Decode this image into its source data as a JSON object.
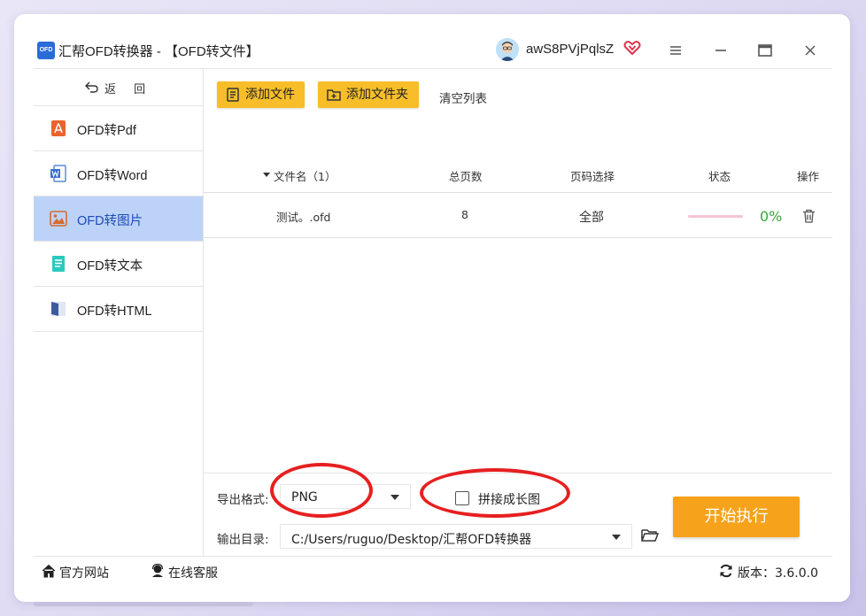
{
  "window": {
    "logo_text": "OFD",
    "title": "汇帮OFD转换器 - 【OFD转文件】",
    "username": "awS8PVjPqlsZ"
  },
  "sidebar": {
    "back_label": "返 回",
    "items": [
      {
        "label": "OFD转Pdf",
        "icon": "pdf-icon",
        "color": "#e8642e"
      },
      {
        "label": "OFD转Word",
        "icon": "word-icon",
        "color": "#3b6fd0"
      },
      {
        "label": "OFD转图片",
        "icon": "image-icon",
        "color": "#d96a2b",
        "active": true
      },
      {
        "label": "OFD转文本",
        "icon": "text-icon",
        "color": "#2bc9c0"
      },
      {
        "label": "OFD转HTML",
        "icon": "html-icon",
        "color": "#3d5a9e"
      }
    ]
  },
  "toolbar": {
    "add_file": "添加文件",
    "add_folder": "添加文件夹",
    "clear_list": "清空列表"
  },
  "table": {
    "headers": {
      "name": "文件名（1）",
      "pages": "总页数",
      "page_select": "页码选择",
      "status": "状态",
      "action": "操作"
    },
    "rows": [
      {
        "name": "测试。.ofd",
        "pages": "8",
        "page_select": "全部",
        "progress": 0,
        "progress_text": "0%"
      }
    ]
  },
  "settings": {
    "format_label": "导出格式:",
    "format_value": "PNG",
    "merge_label": "拼接成长图",
    "merge_checked": false,
    "output_label": "输出目录:",
    "output_value": "C:/Users/ruguo/Desktop/汇帮OFD转换器",
    "start_button": "开始执行"
  },
  "footer": {
    "website": "官方网站",
    "support": "在线客服",
    "version": "版本：3.6.0.0"
  },
  "colors": {
    "accent_yellow": "#f7be2a",
    "start_orange": "#f7a21b",
    "active_blue": "#bcd3f7",
    "annotation_red": "#e62020",
    "progress_green": "#3aa53a"
  }
}
